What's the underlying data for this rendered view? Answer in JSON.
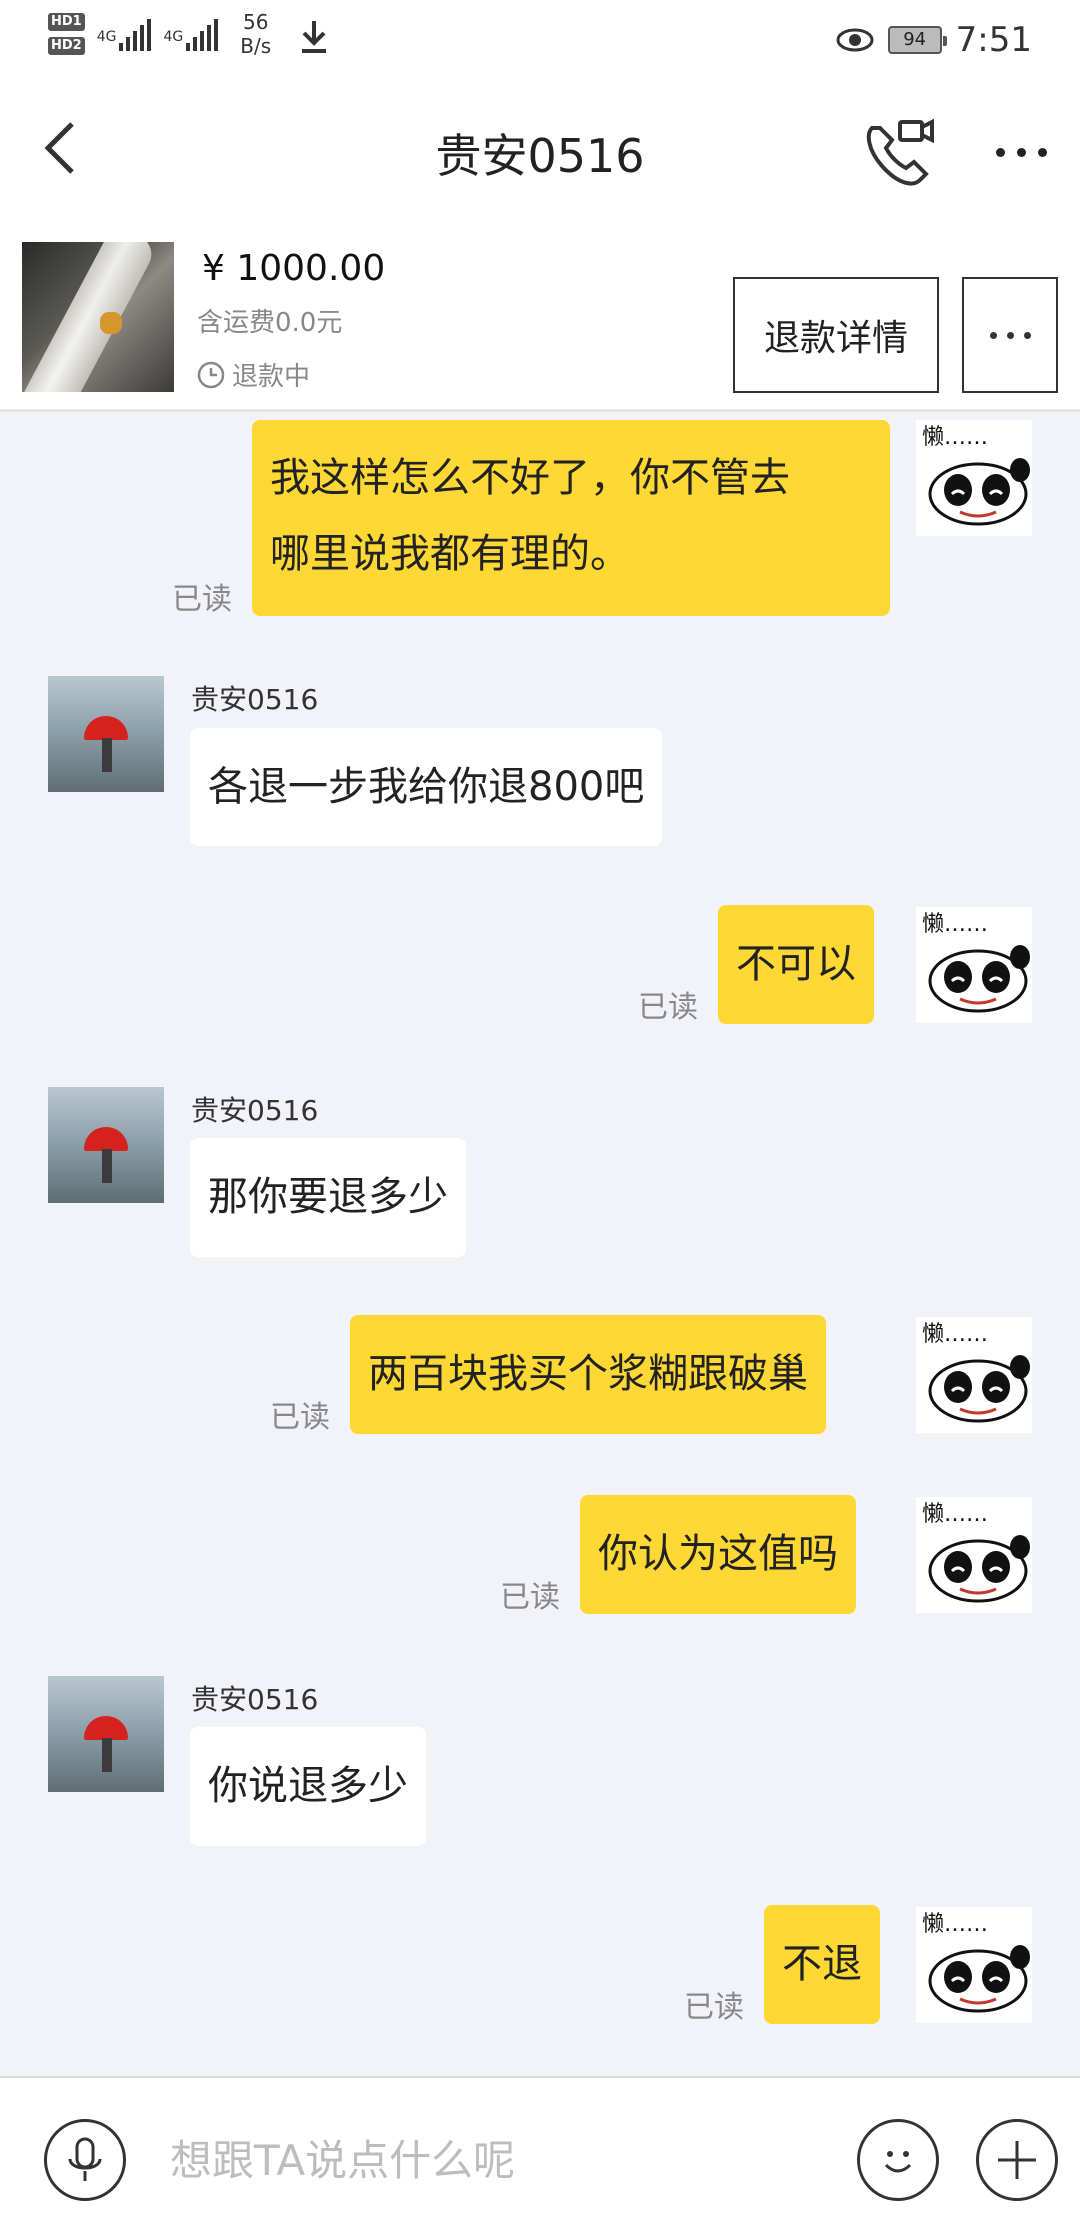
{
  "status_bar": {
    "hd1": "HD1",
    "hd2": "HD2",
    "net1": "4G",
    "net2": "4G",
    "speed_value": "56",
    "speed_unit": "B/s",
    "battery": "94",
    "time": "7:51"
  },
  "header": {
    "title": "贵安0516"
  },
  "order": {
    "price": "¥ 1000.00",
    "shipping": "含运费0.0元",
    "status": "退款中",
    "refund_detail_label": "退款详情"
  },
  "messages": [
    {
      "dir": "out",
      "lines": [
        "我这样怎么不好了，你不管去",
        "哪里说我都有理的。"
      ],
      "read": "已读"
    },
    {
      "dir": "in",
      "sender": "贵安0516",
      "text": "各退一步我给你退800吧"
    },
    {
      "dir": "out",
      "text": "不可以",
      "read": "已读"
    },
    {
      "dir": "in",
      "sender": "贵安0516",
      "text": "那你要退多少"
    },
    {
      "dir": "out",
      "text": "两百块我买个浆糊跟破巢",
      "read": "已读"
    },
    {
      "dir": "out",
      "text": "你认为这值吗",
      "read": "已读"
    },
    {
      "dir": "in",
      "sender": "贵安0516",
      "text": "你说退多少"
    },
    {
      "dir": "out",
      "text": "不退",
      "read": "已读"
    }
  ],
  "sticker_text": "懒……",
  "input": {
    "placeholder": "想跟TA说点什么呢"
  },
  "colors": {
    "out_bubble": "#fdd835",
    "in_bubble": "#ffffff",
    "chat_bg": "#f2f3f8"
  }
}
